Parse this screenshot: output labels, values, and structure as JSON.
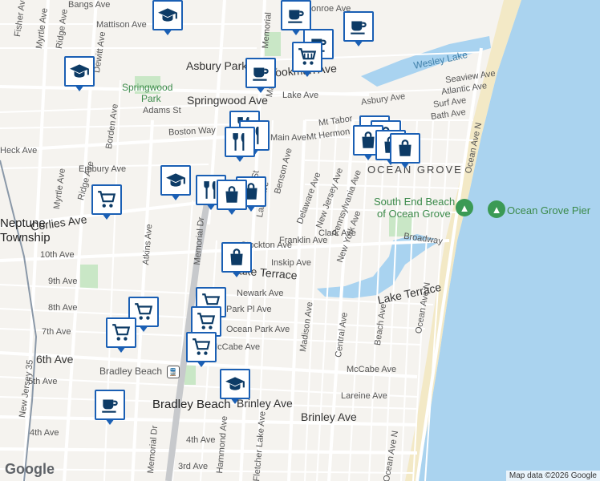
{
  "colors": {
    "water": "#a9d3f0",
    "ocean": "#aad3ef",
    "land": "#f5f3ef",
    "park": "#c9e7c6",
    "beach": "#f3e9c6",
    "marker_border": "#1a5fb4",
    "icon": "#0d3b66"
  },
  "towns": {
    "neptune_line1": "Neptune",
    "neptune_line2": "Township",
    "ocean_grove": "OCEAN GROVE",
    "bradley_beach": "Bradley Beach",
    "bradley_beach_station": "Bradley Beach",
    "asbury_park": "Asbury Park"
  },
  "parks": {
    "springwood_line1": "Springwood",
    "springwood_line2": "Park"
  },
  "water": {
    "wesley_lake": "Wesley Lake"
  },
  "pois": {
    "south_end_line1": "South End Beach",
    "south_end_line2": "of Ocean Grove",
    "pier": "Ocean Grove Pier"
  },
  "streets": {
    "bangs": "Bangs Ave",
    "mattison": "Mattison Ave",
    "springwood": "Springwood Ave",
    "adams": "Adams St",
    "boston": "Boston Way",
    "heck": "Heck Ave",
    "embury": "Embury Ave",
    "corlies": "Corlies Ave",
    "tenth": "10th Ave",
    "ninth": "9th Ave",
    "eighth": "8th Ave",
    "seventh": "7th Ave",
    "sixth": "6th Ave",
    "fifth": "5th Ave",
    "fourth": "4th Ave",
    "third": "3rd Ave",
    "brinley": "Brinley Ave",
    "brinley2": "Brinley Ave",
    "lareine": "Lareine Ave",
    "mccabe": "McCabe Ave",
    "mccabe2": "McCabe Ave",
    "ocean_park": "Ocean Park Ave",
    "park_pl": "Park Pl Ave",
    "newark": "Newark Ave",
    "lake_terrace": "Lake Terrace",
    "lake_terrace2": "Lake Terrace",
    "inskip": "Inskip Ave",
    "stockton": "Stockton Ave",
    "franklin": "Franklin Ave",
    "clark": "Clark Ave",
    "broadway": "Broadway",
    "main": "Main Ave",
    "main_st": "Main St",
    "cookman": "Cookman Ave",
    "lake": "Lake Ave",
    "asbury": "Asbury Ave",
    "seaview": "Seaview Ave",
    "atlantic": "Atlantic Ave",
    "surf": "Surf Ave",
    "bath": "Bath Ave",
    "mt_tabor": "Mt Tabor",
    "mt_hermon": "Mt Hermon",
    "ocean_ave_n": "Ocean Ave N",
    "ocean_ave_n2": "Ocean Ave N",
    "ocean_ave_n3": "Ocean Ave N",
    "benson": "Benson Ave",
    "delaware": "Delaware Ave",
    "new_jersey": "New Jersey Ave",
    "pennsylvania": "Pennsylvania Ave",
    "new_york": "New York Ave",
    "madison": "Madison Ave",
    "central": "Central Ave",
    "beach": "Beach Ave",
    "memorial": "Memorial Dr",
    "memorial2": "Memorial Dr",
    "memorial3": "Memorial",
    "atkins": "Atkins Ave",
    "ridge": "Ridge Ave",
    "ridge2": "Ridge Ave",
    "myrtle": "Myrtle Ave",
    "myrtle2": "Myrtle Ave",
    "fisher": "Fisher Ave",
    "dewitt": "Dewitt Ave",
    "borden": "Borden Ave",
    "nj35": "New Jersey 35",
    "hammond": "Hammond Ave",
    "fletcher_lake": "Fletcher Lake Ave",
    "lake_ave2": "Lake Ave",
    "st": "St",
    "monroe": "onroe Ave",
    "eld": "Eld"
  },
  "markers": [
    {
      "type": "coffee"
    },
    {
      "type": "grad"
    },
    {
      "type": "coffee"
    },
    {
      "type": "coffee"
    },
    {
      "type": "shop"
    },
    {
      "type": "coffee"
    },
    {
      "type": "coffee"
    },
    {
      "type": "food"
    },
    {
      "type": "food"
    },
    {
      "type": "food"
    },
    {
      "type": "bag"
    },
    {
      "type": "bag"
    },
    {
      "type": "bag"
    },
    {
      "type": "bag"
    },
    {
      "type": "bag"
    },
    {
      "type": "grad"
    },
    {
      "type": "food"
    },
    {
      "type": "bag"
    },
    {
      "type": "bag"
    },
    {
      "type": "shop"
    },
    {
      "type": "bag"
    },
    {
      "type": "shop"
    },
    {
      "type": "shop"
    },
    {
      "type": "shop"
    },
    {
      "type": "shop"
    },
    {
      "type": "shop"
    },
    {
      "type": "grad"
    },
    {
      "type": "coffee"
    }
  ],
  "attribution": "Map data ©2026 Google",
  "logo": "Google"
}
